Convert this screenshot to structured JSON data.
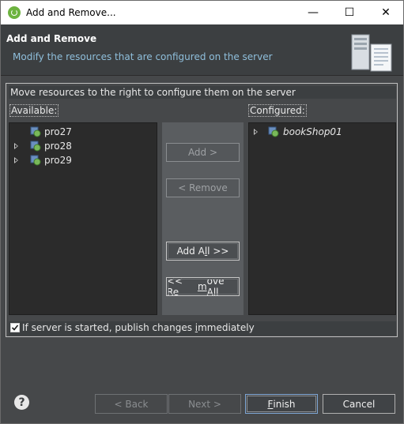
{
  "window": {
    "title": "Add and Remove...",
    "minimize": "—",
    "maximize": "☐",
    "close": "✕"
  },
  "header": {
    "title": "Add and Remove",
    "description": "Modify the resources that are configured on the server"
  },
  "group": {
    "caption": "Move resources to the right to configure them on the server"
  },
  "available": {
    "label": "Available:",
    "items": [
      {
        "label": "pro27",
        "expandable": false
      },
      {
        "label": "pro28",
        "expandable": true
      },
      {
        "label": "pro29",
        "expandable": true
      }
    ]
  },
  "configured": {
    "label": "Configured:",
    "items": [
      {
        "label": "bookShop01",
        "expandable": true
      }
    ]
  },
  "buttons": {
    "add": "Add >",
    "remove": "< Remove",
    "add_all_pre": "Add A",
    "add_all_u": "l",
    "add_all_post": "l >>",
    "remove_all_pre": "<< Re",
    "remove_all_u": "m",
    "remove_all_post": "ove All"
  },
  "publish": {
    "checked": true,
    "label_pre": "If server is started, publish changes ",
    "label_u": "i",
    "label_post": "mmediately"
  },
  "footer": {
    "help": "?",
    "back": "< Back",
    "next": "Next >",
    "finish_u": "F",
    "finish_rest": "inish",
    "cancel": "Cancel"
  }
}
